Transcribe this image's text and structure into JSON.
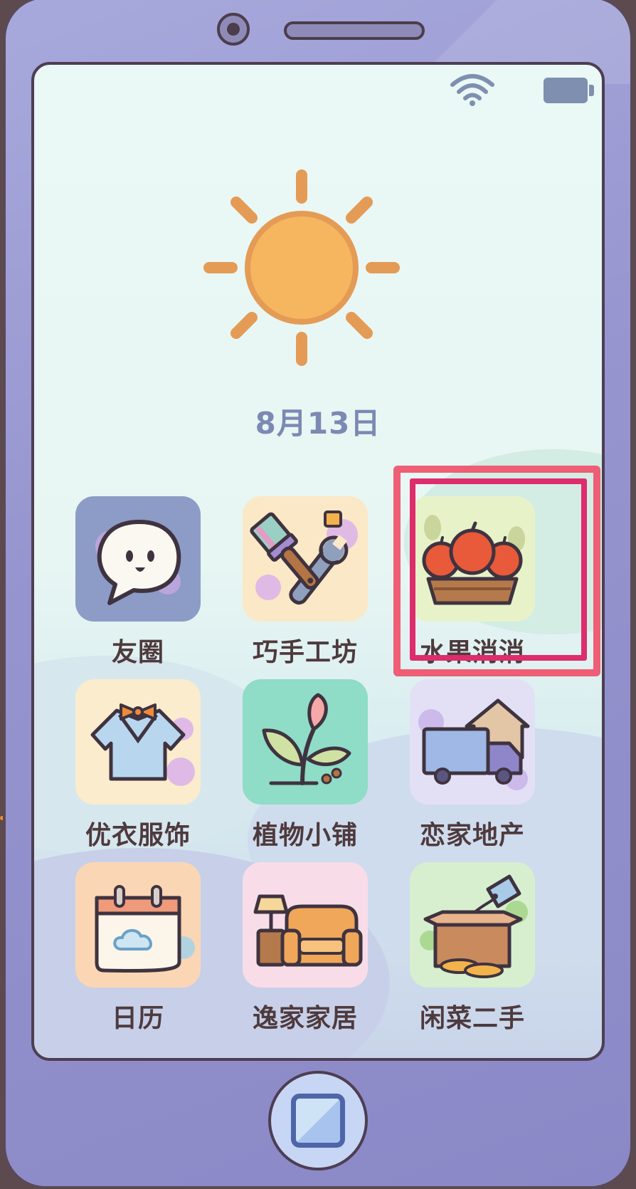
{
  "date": "8月13日",
  "apps": [
    {
      "label": "友圈",
      "icon": "speech-bubble-face-icon"
    },
    {
      "label": "巧手工坊",
      "icon": "brush-wrench-icon"
    },
    {
      "label": "水果消消",
      "icon": "fruit-basket-icon"
    },
    {
      "label": "优衣服饰",
      "icon": "shirt-bowtie-icon"
    },
    {
      "label": "植物小铺",
      "icon": "plant-sprout-icon"
    },
    {
      "label": "恋家地产",
      "icon": "moving-truck-house-icon"
    },
    {
      "label": "日历",
      "icon": "calendar-cloud-icon"
    },
    {
      "label": "逸家家居",
      "icon": "sofa-lamp-icon"
    },
    {
      "label": "闲菜二手",
      "icon": "box-price-tag-icon"
    }
  ],
  "highlighted_app": "水果消消",
  "colors": {
    "phone_body": "#9795cf",
    "screen_bg": "#eaf8f6",
    "sun": "#f5b65f",
    "highlight": "#ee5e74",
    "label_text": "#4e3a3d",
    "date_text": "#7b89b3"
  }
}
